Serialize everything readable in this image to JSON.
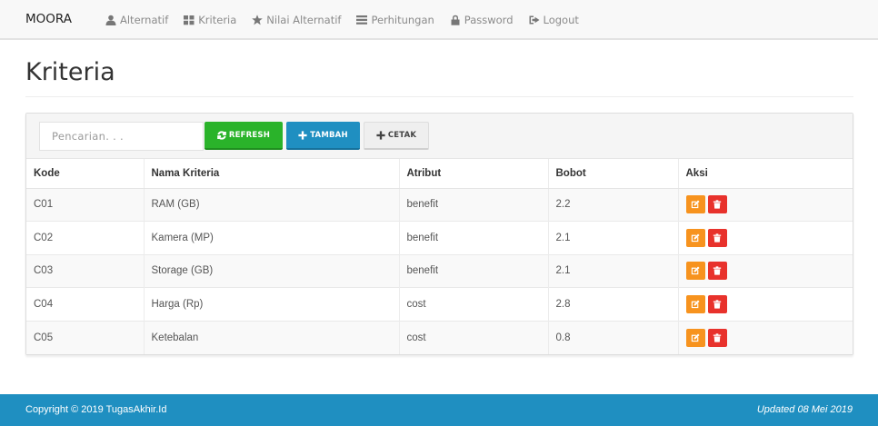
{
  "navbar": {
    "brand": "MOORA",
    "items": [
      {
        "label": "Alternatif",
        "icon": "user-icon"
      },
      {
        "label": "Kriteria",
        "icon": "grid-icon"
      },
      {
        "label": "Nilai Alternatif",
        "icon": "star-icon"
      },
      {
        "label": "Perhitungan",
        "icon": "list-icon"
      },
      {
        "label": "Password",
        "icon": "lock-icon"
      },
      {
        "label": "Logout",
        "icon": "logout-icon"
      }
    ]
  },
  "page": {
    "title": "Kriteria"
  },
  "toolbar": {
    "search_placeholder": "Pencarian. . .",
    "refresh_label": "REFRESH",
    "tambah_label": "TAMBAH",
    "cetak_label": "CETAK"
  },
  "table": {
    "headers": [
      "Kode",
      "Nama Kriteria",
      "Atribut",
      "Bobot",
      "Aksi"
    ],
    "rows": [
      {
        "kode": "C01",
        "nama": "RAM (GB)",
        "atribut": "benefit",
        "bobot": "2.2"
      },
      {
        "kode": "C02",
        "nama": "Kamera (MP)",
        "atribut": "benefit",
        "bobot": "2.1"
      },
      {
        "kode": "C03",
        "nama": "Storage (GB)",
        "atribut": "benefit",
        "bobot": "2.1"
      },
      {
        "kode": "C04",
        "nama": "Harga (Rp)",
        "atribut": "cost",
        "bobot": "2.8"
      },
      {
        "kode": "C05",
        "nama": "Ketebalan",
        "atribut": "cost",
        "bobot": "0.8"
      }
    ]
  },
  "footer": {
    "copyright": "Copyright © 2019 TugasAkhir.Id",
    "updated": "Updated 08 Mei 2019"
  },
  "colors": {
    "refresh": "#2ab32a",
    "primary": "#1f8fc1",
    "edit": "#f7931e",
    "delete": "#e8322c"
  }
}
